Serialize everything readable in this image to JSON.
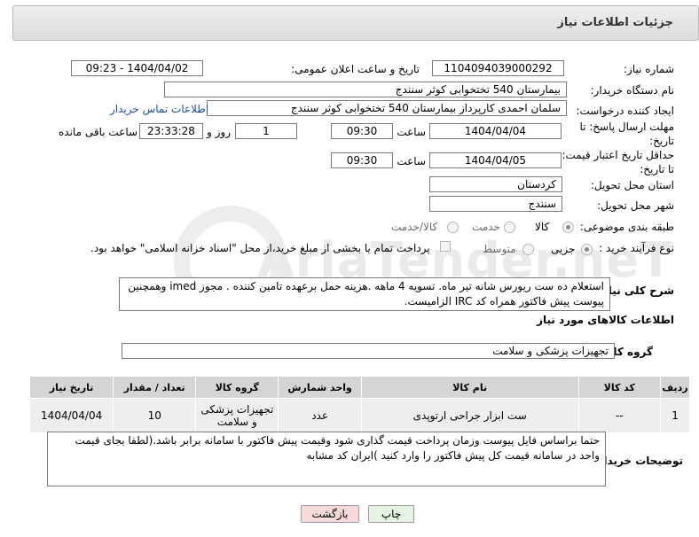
{
  "header": {
    "title": "جزئیات اطلاعات نیاز"
  },
  "watermark": {
    "text": "AriaTender.neT"
  },
  "fields": {
    "need_number_label": "شماره نیاز:",
    "need_number": "1104094039000292",
    "announce_label": "تاریخ و ساعت اعلان عمومی:",
    "announce_value": "1404/04/02 - 09:23",
    "buyer_org_label": "نام دستگاه خریدار:",
    "buyer_org": "بیمارستان 540 تختخوابی کوثر سنندج",
    "creator_label": "ایجاد کننده درخواست:",
    "creator": "سلمان احمدی کارپرداز بیمارستان 540 تختخوابی کوثر سنندج",
    "contact_link": "اطلاعات تماس خریدار",
    "deadline_label": "مهلت ارسال پاسخ: تا تاریخ:",
    "deadline_date": "1404/04/04",
    "time_label": "ساعت",
    "deadline_time": "09:30",
    "days_value": "1",
    "days_label": "روز و",
    "remaining_time": "23:33:28",
    "remaining_label": "ساعت باقی مانده",
    "validity_label": "حداقل تاریخ اعتبار قیمت: تا تاریخ:",
    "validity_date": "1404/04/05",
    "validity_time": "09:30",
    "province_label": "استان محل تحویل:",
    "province": "کردستان",
    "city_label": "شهر محل تحویل:",
    "city": "سنندج",
    "category_label": "طبقه بندی موضوعی:",
    "category_options": [
      "کالا",
      "خدمت",
      "کالا/خدمت"
    ],
    "category_selected": "کالا",
    "process_label": "نوع فرآیند خرید :",
    "process_options": [
      "جزیی",
      "متوسط"
    ],
    "process_selected": "جزیی",
    "payment_note": "پرداخت تمام یا بخشی از مبلغ خرید،از محل \"اسناد خزانه اسلامی\" خواهد بود."
  },
  "general_desc": {
    "label": "شرح کلی نیاز:",
    "text": "استعلام ده ست ریورس شانه  تیر ماه. تسویه 4 ماهه .هزینه حمل برعهده تامین کننده . مجوز imed وهمچنین پیوست پیش فاکتور همراه کد IRC  الزامیست."
  },
  "goods_section": {
    "title": "اطلاعات کالاهای مورد نیاز",
    "group_label": "گروه کالا:",
    "group_value": "تجهیزات پزشکی و سلامت"
  },
  "table": {
    "headers": [
      "ردیف",
      "کد کالا",
      "نام کالا",
      "واحد شمارش",
      "گروه کالا",
      "تعداد / مقدار",
      "تاریخ نیاز"
    ],
    "rows": [
      [
        "1",
        "--",
        "ست ابزار جراحی ارتوپدی",
        "عدد",
        "تجهیزات پزشکی و سلامت",
        "10",
        "1404/04/04"
      ]
    ]
  },
  "buyer_notes": {
    "label": "توضیحات خریدار:",
    "text": "حتما براساس فایل پیوست  وزمان پرداخت قیمت گذاری شود وقیمت پیش فاکتور با سامانه برابر باشد.(لطفا بجای قیمت واحد در سامانه قیمت کل پیش فاکتور را وارد کنید )ایران کد مشابه"
  },
  "buttons": {
    "print": "چاپ",
    "back": "بازگشت"
  },
  "colors": {
    "link": "#1a4fa0",
    "back_button": "#f6dada",
    "print_button": "#e6f3e0",
    "table_header": "#d5d5d5"
  }
}
